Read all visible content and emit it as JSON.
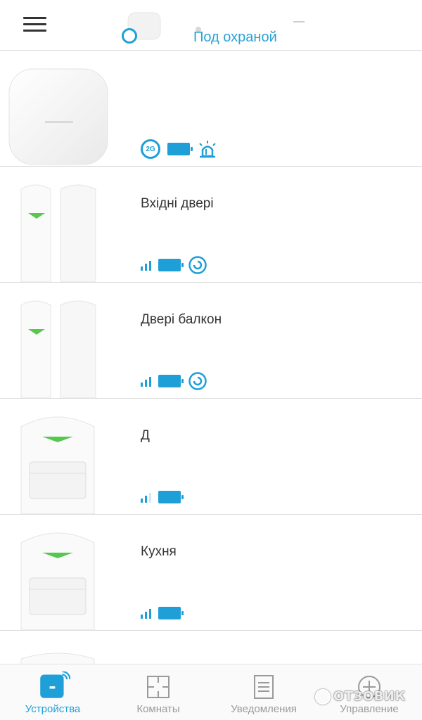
{
  "header": {
    "status": "Под охраной",
    "accent": "#29a3d6"
  },
  "devices": [
    {
      "name": "",
      "type": "hub",
      "icons": [
        "2g-icon",
        "battery-icon",
        "siren-icon"
      ]
    },
    {
      "name": "Вхідні двері",
      "type": "door-sensor",
      "icons": [
        "signal-icon",
        "battery-icon",
        "delay-icon"
      ]
    },
    {
      "name": "Двері балкон",
      "type": "door-sensor",
      "icons": [
        "signal-icon",
        "battery-icon",
        "delay-icon"
      ]
    },
    {
      "name": "Д",
      "type": "motion-sensor",
      "icons": [
        "signal-icon",
        "battery-icon"
      ]
    },
    {
      "name": "Кухня",
      "type": "motion-sensor",
      "icons": [
        "signal-icon",
        "battery-icon"
      ]
    }
  ],
  "badges": {
    "network": "2G"
  },
  "nav": {
    "items": [
      {
        "label": "Устройства",
        "icon": "devices-icon",
        "active": true
      },
      {
        "label": "Комнаты",
        "icon": "rooms-icon",
        "active": false
      },
      {
        "label": "Уведомления",
        "icon": "notifications-icon",
        "active": false
      },
      {
        "label": "Управление",
        "icon": "control-icon",
        "active": false
      }
    ]
  },
  "watermark": "ОТЗОВИК",
  "colors": {
    "accent": "#1e9fd8",
    "divider": "#d9d9d9"
  }
}
